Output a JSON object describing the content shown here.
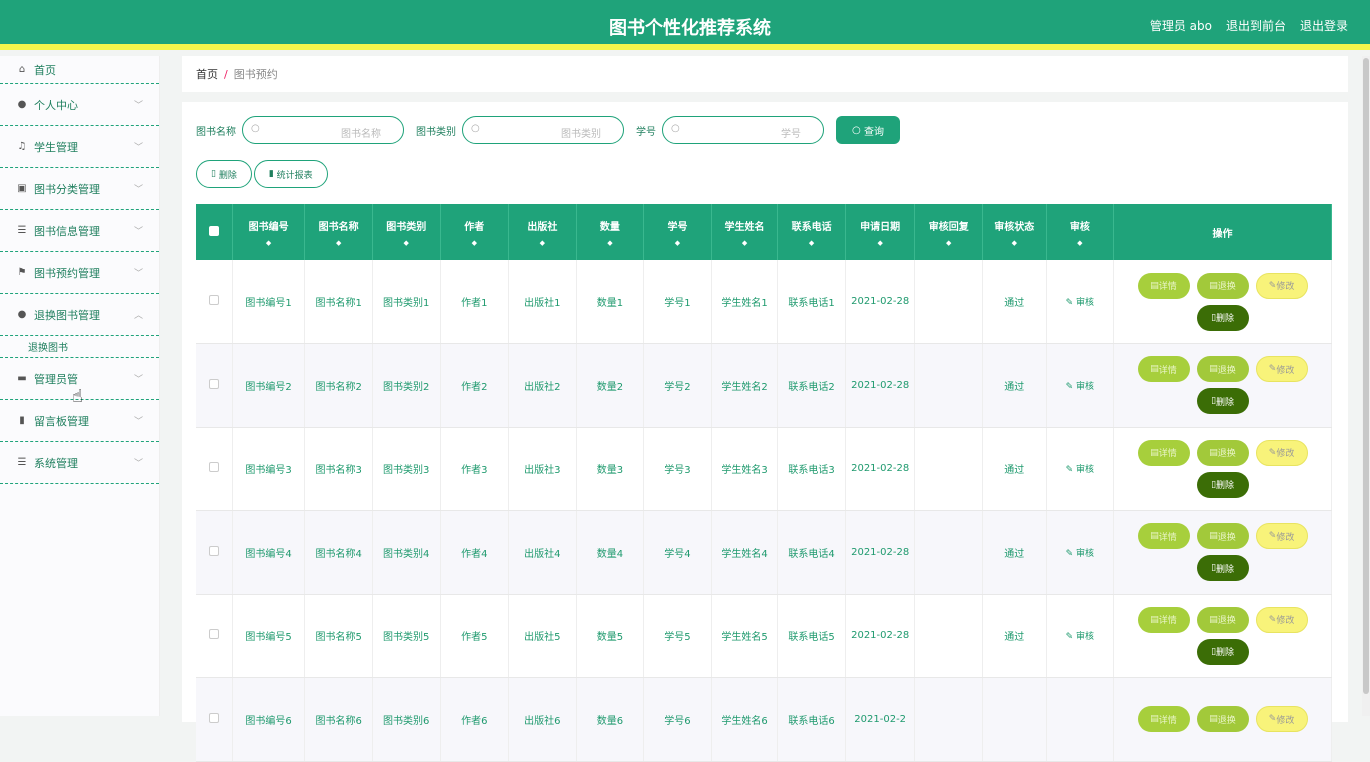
{
  "header": {
    "title": "图书个性化推荐系统",
    "admin": "管理员 abo",
    "to_front": "退出到前台",
    "logout": "退出登录"
  },
  "sidebar": {
    "items": [
      {
        "label": "首页",
        "icon": "home-icon",
        "glyph": "⌂"
      },
      {
        "label": "个人中心",
        "icon": "user-icon",
        "glyph": "●"
      },
      {
        "label": "学生管理",
        "icon": "mic-icon",
        "glyph": "♫"
      },
      {
        "label": "图书分类管理",
        "icon": "chart-icon",
        "glyph": "▣"
      },
      {
        "label": "图书信息管理",
        "icon": "list-icon",
        "glyph": "☰"
      },
      {
        "label": "图书预约管理",
        "icon": "flag-icon",
        "glyph": "⚑"
      },
      {
        "label": "退换图书管理",
        "icon": "user-icon",
        "glyph": "●"
      },
      {
        "label": "管理员管",
        "icon": "monitor-icon",
        "glyph": "▬"
      },
      {
        "label": "留言板管理",
        "icon": "bar-chart-icon",
        "glyph": "▮"
      },
      {
        "label": "系统管理",
        "icon": "list-icon",
        "glyph": "☰"
      }
    ],
    "sub_item": "退换图书"
  },
  "breadcrumb": {
    "home": "首页",
    "sep": "/",
    "current": "图书预约"
  },
  "search": {
    "label1": "图书名称",
    "ph1": "图书名称",
    "label2": "图书类别",
    "ph2": "图书类别",
    "label3": "学号",
    "ph3": "学号",
    "query": "查询"
  },
  "tools": {
    "delete": "删除",
    "report": "统计报表"
  },
  "table": {
    "headers": [
      "图书编号",
      "图书名称",
      "图书类别",
      "作者",
      "出版社",
      "数量",
      "学号",
      "学生姓名",
      "联系电话",
      "申请日期",
      "审核回复",
      "审核状态",
      "审核",
      "操作"
    ],
    "rows": [
      {
        "c": [
          "图书编号1",
          "图书名称1",
          "图书类别1",
          "作者1",
          "出版社1",
          "数量1",
          "学号1",
          "学生姓名1",
          "联系电话1",
          "2021-02-28",
          "",
          "通过"
        ]
      },
      {
        "c": [
          "图书编号2",
          "图书名称2",
          "图书类别2",
          "作者2",
          "出版社2",
          "数量2",
          "学号2",
          "学生姓名2",
          "联系电话2",
          "2021-02-28",
          "",
          "通过"
        ]
      },
      {
        "c": [
          "图书编号3",
          "图书名称3",
          "图书类别3",
          "作者3",
          "出版社3",
          "数量3",
          "学号3",
          "学生姓名3",
          "联系电话3",
          "2021-02-28",
          "",
          "通过"
        ]
      },
      {
        "c": [
          "图书编号4",
          "图书名称4",
          "图书类别4",
          "作者4",
          "出版社4",
          "数量4",
          "学号4",
          "学生姓名4",
          "联系电话4",
          "2021-02-28",
          "",
          "通过"
        ]
      },
      {
        "c": [
          "图书编号5",
          "图书名称5",
          "图书类别5",
          "作者5",
          "出版社5",
          "数量5",
          "学号5",
          "学生姓名5",
          "联系电话5",
          "2021-02-28",
          "",
          "通过"
        ]
      },
      {
        "c": [
          "图书编号6",
          "图书名称6",
          "图书类别6",
          "作者6",
          "出版社6",
          "数量6",
          "学号6",
          "学生姓名6",
          "联系电话6",
          "2021-02-2",
          "",
          ""
        ]
      }
    ],
    "audit_label": "审核",
    "ops": {
      "detail": "详情",
      "exchange": "退换",
      "edit": "修改",
      "delete": "删除"
    }
  },
  "colors": {
    "primary": "#1fa37a",
    "header_accent": "#f5f54c",
    "ops_green": "#a7cf3c",
    "ops_yellow": "#f8f37a",
    "ops_dark": "#3b6d06"
  }
}
